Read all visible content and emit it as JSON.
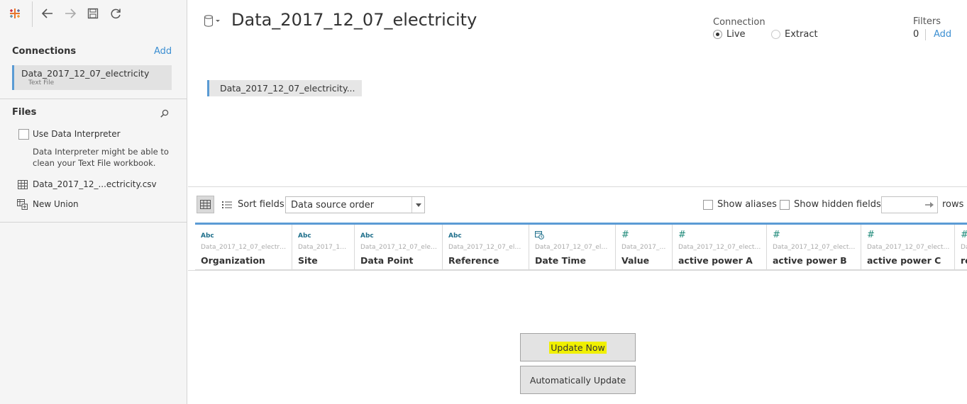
{
  "data_source": {
    "title": "Data_2017_12_07_electricity"
  },
  "connection": {
    "label": "Connection",
    "options": [
      {
        "label": "Live",
        "selected": true
      },
      {
        "label": "Extract",
        "selected": false
      }
    ]
  },
  "filters": {
    "label": "Filters",
    "count": "0",
    "add_label": "Add"
  },
  "sidebar": {
    "connections_title": "Connections",
    "connections_add": "Add",
    "connection_item": {
      "name": "Data_2017_12_07_electricity",
      "type": "Text File"
    },
    "files_title": "Files",
    "use_interpreter_label": "Use Data Interpreter",
    "interpreter_description": "Data Interpreter might be able to clean your Text File workbook.",
    "files": [
      {
        "label": "Data_2017_12_...ectricity.csv",
        "icon": "table-icon"
      },
      {
        "label": "New Union",
        "icon": "union-icon"
      }
    ]
  },
  "canvas": {
    "table_label": "Data_2017_12_07_electricity..."
  },
  "grid_toolbar": {
    "sort_label": "Sort fields",
    "sort_value": "Data source order",
    "show_aliases": "Show aliases",
    "show_hidden": "Show hidden fields",
    "rows_label": "rows"
  },
  "columns": [
    {
      "type": "Abc",
      "source": "Data_2017_12_07_electricit...",
      "name": "Organization"
    },
    {
      "type": "Abc",
      "source": "Data_2017_12_...",
      "name": "Site"
    },
    {
      "type": "Abc",
      "source": "Data_2017_12_07_electr...",
      "name": "Data Point"
    },
    {
      "type": "Abc",
      "source": "Data_2017_12_07_elect...",
      "name": "Reference"
    },
    {
      "type": "date",
      "source": "Data_2017_12_07_elect...",
      "name": "Date Time"
    },
    {
      "type": "#",
      "source": "Data_2017_12...",
      "name": "Value"
    },
    {
      "type": "#",
      "source": "Data_2017_12_07_electrici...",
      "name": "active power A"
    },
    {
      "type": "#",
      "source": "Data_2017_12_07_electrici...",
      "name": "active power B"
    },
    {
      "type": "#",
      "source": "Data_2017_12_07_electric...",
      "name": "active power C"
    },
    {
      "type": "#",
      "source": "Da",
      "name": "re"
    }
  ],
  "actions": {
    "update_now": "Update Now",
    "auto_update": "Automatically Update"
  },
  "colors": {
    "accent_blue": "#5b9bd5",
    "link_blue": "#3c8fd2",
    "highlight_yellow": "#f0f000"
  }
}
